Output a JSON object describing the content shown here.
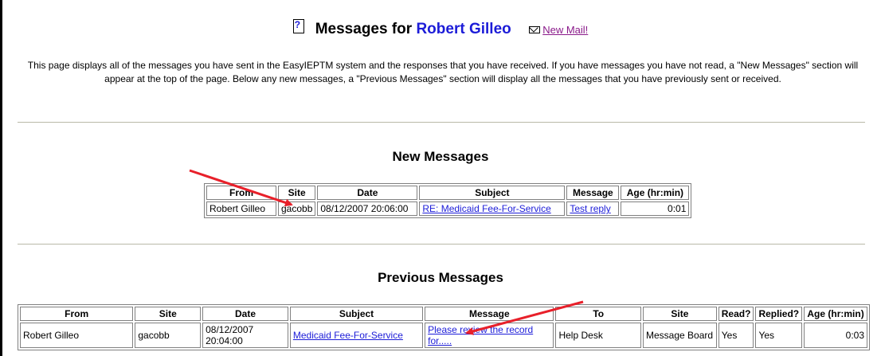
{
  "header": {
    "title_prefix": "Messages for ",
    "user_name": "Robert Gilleo",
    "new_mail_label": "New Mail!"
  },
  "intro": "This page displays all of the messages you have sent in the EasyIEPTM system and the responses that you have received. If you have messages you have not read, a \"New Messages\" section will appear at the top of the page. Below any new messages, a \"Previous Messages\" section will display all the messages that you have previously sent or received.",
  "new_messages": {
    "title": "New Messages",
    "columns": [
      "From",
      "Site",
      "Date",
      "Subject",
      "Message",
      "Age (hr:min)"
    ],
    "rows": [
      {
        "from": "Robert Gilleo",
        "site": "gacobb",
        "date": "08/12/2007 20:06:00",
        "subject": "RE: Medicaid Fee-For-Service",
        "message": "Test reply",
        "age": "0:01"
      }
    ]
  },
  "previous_messages": {
    "title": "Previous Messages",
    "columns": [
      "From",
      "Site",
      "Date",
      "Subject",
      "Message",
      "To",
      "Site",
      "Read?",
      "Replied?",
      "Age (hr:min)"
    ],
    "rows": [
      {
        "from": "Robert Gilleo",
        "site": "gacobb",
        "date": "08/12/2007 20:04:00",
        "subject": "Medicaid Fee-For-Service",
        "message": "Please review the record for.....",
        "to": "Help Desk",
        "to_site": "Message Board",
        "read": "Yes",
        "replied": "Yes",
        "age": "0:03"
      }
    ]
  },
  "colors": {
    "link": "#1c1cd8",
    "visited_link": "#8a1a8a",
    "annotation_arrow": "#e8202a"
  }
}
